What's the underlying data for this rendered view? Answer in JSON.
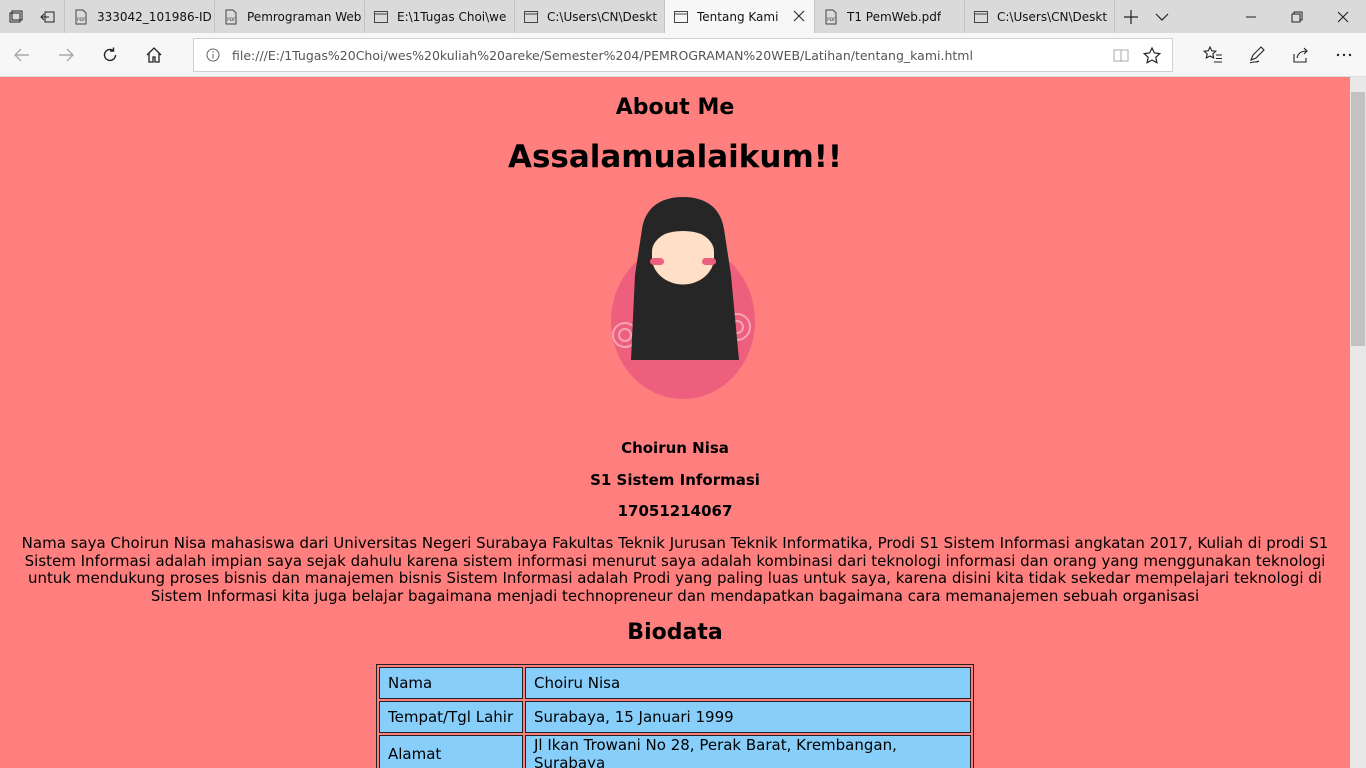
{
  "tabs": [
    {
      "title": "333042_101986-ID",
      "icon": "pdf-icon",
      "active": false
    },
    {
      "title": "Pemrograman Web",
      "icon": "pdf-icon",
      "active": false
    },
    {
      "title": "E:\\1Tugas Choi\\we",
      "icon": "page-icon",
      "active": false
    },
    {
      "title": "C:\\Users\\CN\\Deskt",
      "icon": "page-icon",
      "active": false
    },
    {
      "title": "Tentang Kami",
      "icon": "page-icon",
      "active": true
    },
    {
      "title": "T1 PemWeb.pdf",
      "icon": "pdf-icon",
      "active": false
    },
    {
      "title": "C:\\Users\\CN\\Deskt",
      "icon": "page-icon",
      "active": false
    }
  ],
  "address": {
    "url": "file:///E:/1Tugas%20Choi/wes%20kuliah%20areke/Semester%204/PEMROGRAMAN%20WEB/Latihan/tentang_kami.html"
  },
  "page": {
    "heading": "About Me",
    "greeting": "Assalamualaikum!!",
    "name": "Choirun Nisa",
    "program": "S1 Sistem Informasi",
    "nim": "17051214067",
    "description": "Nama saya Choirun Nisa mahasiswa dari Universitas Negeri Surabaya Fakultas Teknik Jurusan Teknik Informatika, Prodi S1 Sistem Informasi angkatan 2017, Kuliah di prodi S1 Sistem Informasi adalah impian saya sejak dahulu karena sistem informasi menurut saya adalah kombinasi dari teknologi informasi dan orang yang menggunakan teknologi untuk mendukung proses bisnis dan manajemen bisnis Sistem Informasi adalah Prodi yang paling luas untuk saya, karena disini kita tidak sekedar mempelajari teknologi di Sistem Informasi kita juga belajar bagaimana menjadi technopreneur dan mendapatkan bagaimana cara memanajemen sebuah organisasi",
    "biodata_title": "Biodata",
    "biodata": [
      {
        "label": "Nama",
        "value": "Choiru Nisa"
      },
      {
        "label": "Tempat/Tgl Lahir",
        "value": "Surabaya, 15 Januari 1999"
      },
      {
        "label": "Alamat",
        "value": "Jl Ikan Trowani No 28, Perak Barat, Krembangan, Surabaya"
      }
    ]
  },
  "colors": {
    "page_background": "#ff7f7f",
    "table_cell": "#87cefa"
  }
}
